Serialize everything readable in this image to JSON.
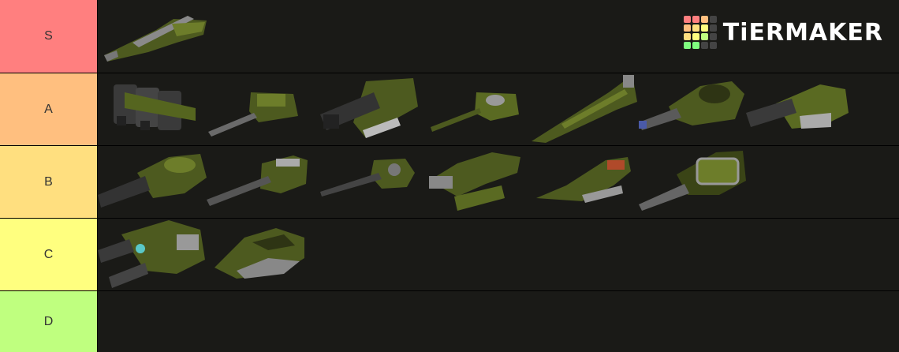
{
  "brand": {
    "name": "TiERMAKER",
    "grid_colors": [
      "#ff7f7f",
      "#ff7f7f",
      "#ffbf7f",
      "#444444",
      "#ffbf7f",
      "#ffdf7f",
      "#ffff7f",
      "#444444",
      "#ffdf7f",
      "#ffff7f",
      "#bfff7f",
      "#444444",
      "#7fff7f",
      "#7fff7f",
      "#444444",
      "#444444"
    ]
  },
  "tiers": [
    {
      "label": "S",
      "color": "#ff7f7f",
      "items": [
        "turret-s-1"
      ]
    },
    {
      "label": "A",
      "color": "#ffbf7f",
      "items": [
        "turret-a-1",
        "turret-a-2",
        "turret-a-3",
        "turret-a-4",
        "turret-a-5",
        "turret-a-6",
        "turret-a-7"
      ]
    },
    {
      "label": "B",
      "color": "#ffdf7f",
      "items": [
        "turret-b-1",
        "turret-b-2",
        "turret-b-3",
        "turret-b-4",
        "turret-b-5",
        "turret-b-6"
      ]
    },
    {
      "label": "C",
      "color": "#ffff7f",
      "items": [
        "turret-c-1",
        "turret-c-2"
      ]
    },
    {
      "label": "D",
      "color": "#bfff7f",
      "items": []
    }
  ]
}
